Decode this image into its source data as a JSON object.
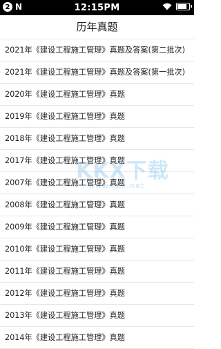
{
  "status_bar": {
    "badge": "2",
    "logo": "N",
    "time": "12:15PM",
    "icons": [
      "wifi-icon",
      "battery-icon"
    ]
  },
  "header": {
    "title": "历年真题"
  },
  "list": {
    "items": [
      "2021年《建设工程施工管理》真题及答案(第二批次)",
      "2021年《建设工程施工管理》真题及答案(第一批次)",
      "2020年《建设工程施工管理》真题",
      "2019年《建设工程施工管理》真题",
      "2018年《建设工程施工管理》真题",
      "2017年《建设工程施工管理》真题",
      "2007年《建设工程施工管理》真题",
      "2008年《建设工程施工管理》真题",
      "2009年《建设工程施工管理》真题",
      "2010年《建设工程施工管理》真题",
      "2011年《建设工程施工管理》真题",
      "2012年《建设工程施工管理》真题",
      "2013年《建设工程施工管理》真题",
      "2014年《建设工程施工管理》真题"
    ]
  },
  "watermark": {
    "brand": "KKX下载",
    "url": "www.kkx.net"
  },
  "colors": {
    "status_bar_bg": "#000000",
    "divider": "#e6e6e6",
    "text": "#222222",
    "watermark": "#50aae6"
  }
}
